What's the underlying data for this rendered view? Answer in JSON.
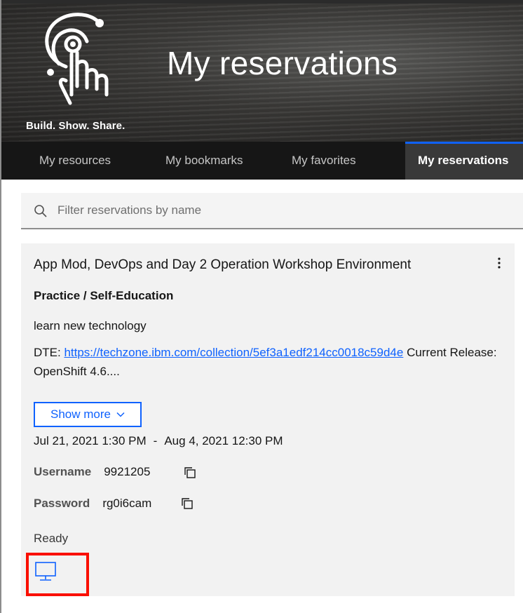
{
  "hero": {
    "tagline": "Build. Show. Share.",
    "title": "My reservations"
  },
  "tabs": [
    {
      "label": "My resources",
      "active": false
    },
    {
      "label": "My bookmarks",
      "active": false
    },
    {
      "label": "My favorites",
      "active": false
    },
    {
      "label": "My reservations",
      "active": true
    }
  ],
  "search": {
    "placeholder": "Filter reservations by name",
    "value": ""
  },
  "reservation": {
    "title": "App Mod, DevOps and Day 2 Operation Workshop Environment",
    "type": "Practice / Self-Education",
    "purpose": "learn new technology",
    "desc_prefix": "DTE: ",
    "desc_link": "https://techzone.ibm.com/collection/5ef3a1edf214cc0018c59d4e",
    "desc_suffix": " Current Release: OpenShift 4.6....",
    "show_more_label": "Show more",
    "start": "Jul 21, 2021 1:30 PM",
    "date_separator": "-",
    "end": "Aug 4, 2021 12:30 PM",
    "username_label": "Username",
    "username": "9921205",
    "password_label": "Password",
    "password": "rg0i6cam",
    "status": "Ready"
  },
  "colors": {
    "accent": "#0f62fe",
    "tab_bar": "#161616",
    "card_bg": "#f2f2f2",
    "highlight_box": "#fa0f00"
  },
  "icons": [
    "touch-logo-icon",
    "search-icon",
    "overflow-menu-icon",
    "chevron-down-icon",
    "copy-icon",
    "monitor-icon"
  ]
}
